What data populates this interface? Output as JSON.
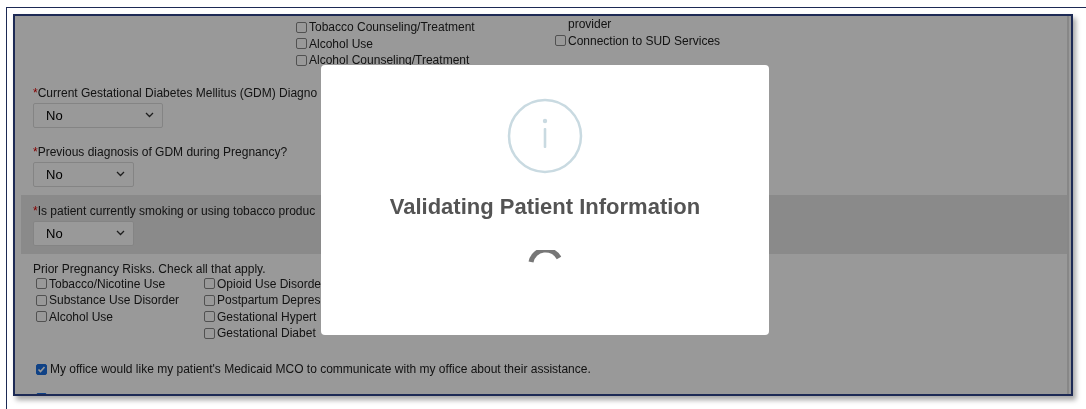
{
  "top_options": [
    [
      {
        "kind": "checkbox",
        "label": "Tobacco Counseling/Treatment",
        "checked": false
      },
      {
        "kind": "checkbox",
        "label": "Alcohol Use",
        "checked": false
      },
      {
        "kind": "checkbox",
        "label": "Alcohol Counseling/Treatment",
        "checked": false
      }
    ],
    [
      {
        "kind": "text",
        "label": "provider"
      },
      {
        "kind": "checkbox",
        "label": "Connection to SUD Services",
        "checked": false
      }
    ]
  ],
  "questions": [
    {
      "required_mark": "*",
      "label": "Current Gestational Diabetes Mellitus (GDM) Diagno",
      "value": "No",
      "shaded": false
    },
    {
      "required_mark": "*",
      "label": "Previous diagnosis of GDM during Pregnancy?",
      "value": "No",
      "shaded": false
    },
    {
      "required_mark": "*",
      "label": "Is patient currently smoking or using tobacco produc",
      "value": "No",
      "shaded": true
    }
  ],
  "prior_risks": {
    "heading": "Prior Pregnancy Risks.  Check all that apply.",
    "columns": [
      [
        {
          "label": "Tobacco/Nicotine Use",
          "checked": false
        },
        {
          "label": "Substance Use Disorder",
          "checked": false
        },
        {
          "label": "Alcohol Use",
          "checked": false
        }
      ],
      [
        {
          "label": "Opioid Use Disorde",
          "checked": false
        },
        {
          "label": "Postpartum Depres",
          "checked": false
        },
        {
          "label": "Gestational Hypert",
          "checked": false
        },
        {
          "label": "Gestational Diabet",
          "checked": false
        }
      ]
    ]
  },
  "consents": [
    {
      "label": "My office would like my patient's Medicaid MCO to communicate with my office about their assistance.",
      "checked": true
    },
    {
      "checked": true
    }
  ],
  "modal": {
    "title": "Validating Patient Information",
    "loading": true
  }
}
